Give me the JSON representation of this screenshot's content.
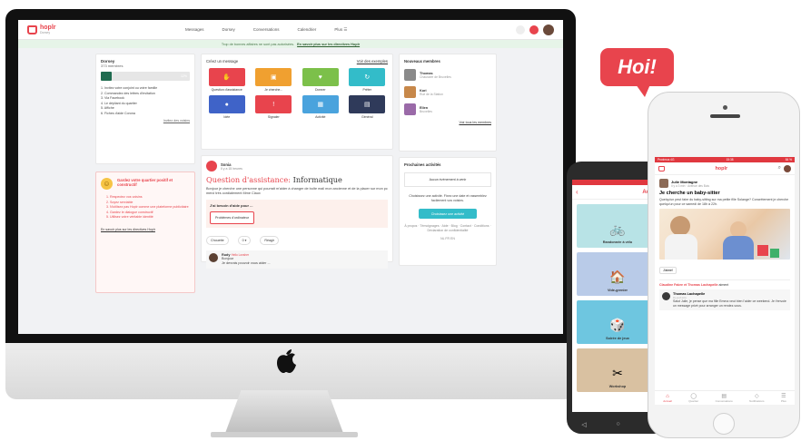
{
  "bubble": {
    "text": "Hoi!"
  },
  "desktop": {
    "logo": {
      "name": "hoplr",
      "sub": "Dorsey"
    },
    "nav": [
      "Messages",
      "Dorsey",
      "Conversations",
      "Calendrier",
      "Plus ☰"
    ],
    "banner": {
      "text": "Trop de bonnes affaires ne sont pas autorisées.",
      "link": "En savoir plus sur les directives Hoplr"
    },
    "membership": {
      "title": "Dorsey",
      "count": "373 membres",
      "progress_label": "12%",
      "progress_fraction": 0.12,
      "steps": [
        "1. Invitez votre conjoint ou votre famille",
        "2. Commandez des lettres d'invitation",
        "3. Via Facebook",
        "4. Le dépliant du quartier",
        "5. Affiche",
        "6. Fiches d'aide Corona"
      ],
      "link": "Invitez des voisins"
    },
    "guard": {
      "title": "Gardez votre quartier positif et constructif",
      "items": [
        "1. Respectez vos voisins",
        "2. Soyez serviable",
        "3. N'utilisez pas Hoplr comme une plateforme publicitaire",
        "4. Gardez le dialogue constructif",
        "5. Utilisez votre véritable identité"
      ],
      "link": "En savoir plus sur les directives Hoplr"
    },
    "create": {
      "title": "Créez un message",
      "link": "Voir des exemples",
      "tiles": [
        {
          "label": "Question d'assistance",
          "color": "#e8444d",
          "icon": "✋"
        },
        {
          "label": "Je cherche...",
          "color": "#f0a030",
          "icon": "▣"
        },
        {
          "label": "Donner",
          "color": "#7cc04a",
          "icon": "♥"
        },
        {
          "label": "Prêter",
          "color": "#33bcc9",
          "icon": "↻"
        },
        {
          "label": "Idée",
          "color": "#3f63c8",
          "icon": "●"
        },
        {
          "label": "Signaler",
          "color": "#e8444d",
          "icon": "!"
        },
        {
          "label": "Activité",
          "color": "#4aa3dd",
          "icon": "▦"
        },
        {
          "label": "Général",
          "color": "#2f3a5a",
          "icon": "▤"
        }
      ]
    },
    "post": {
      "author": "Sonia",
      "time": "Il y a 15 heures",
      "title_prefix": "Question d'assistance:",
      "title_topic": "Informatique",
      "body": "Bonjour je cherche une personne qui pourrait m'aider à changer de boîte mail mon ancienne et de la placer sur mon pc merci très cordialement Mme Claux",
      "need_title": "J'ai besoin d'aide pour ...",
      "need_button": "Problèmes d'ordinateur",
      "actions": [
        "Chouette",
        "0 ▾",
        "Réagir"
      ],
      "comment": {
        "name": "Rudy",
        "tag": "Hello Lonsher",
        "text1": "Bonjour",
        "text2": "Je devrais pouvoir vous aider ..."
      }
    },
    "new_members": {
      "title": "Nouveaux membres",
      "members": [
        {
          "name": "Thomas",
          "sub": "Chaussée de Bruxelles",
          "color": "#8a8a8a"
        },
        {
          "name": "Kori",
          "sub": "Rue de la Station",
          "color": "#c7884a"
        },
        {
          "name": "Ellen",
          "sub": "Bruxelles",
          "color": "#9a6aa8"
        }
      ],
      "link": "Voir tous les membres"
    },
    "activities": {
      "title": "Prochaines activités",
      "none": "Aucun événement à venir",
      "desc": "Choisissez une activité. Fixez une date et rassemblez facilement vos voisins.",
      "cta": "Choisissez une activité",
      "footer": "À propos · Témoignages · Aide · Blog · Contact · Conditions · Déclaration de confidentialité",
      "langs": "NL  FR  EN"
    }
  },
  "android": {
    "title": "Activ",
    "tiles": [
      {
        "label": "Randonnée à vélo",
        "color": "#b8e3e6",
        "icon": "🚲"
      },
      {
        "label": "Vide-grenier",
        "color": "#b9cbe8",
        "icon": "🏠"
      },
      {
        "label": "Soirée de jeux",
        "color": "#6ec6e0",
        "icon": "🎲"
      },
      {
        "label": "Workshop",
        "color": "#d9c1a1",
        "icon": "✂"
      }
    ]
  },
  "iphone": {
    "status_left": "Proximus 4G",
    "status_center": "15:38",
    "status_right": "84 %",
    "title": "hoplr",
    "post": {
      "author": "Julie Montagne",
      "time": "Il y a 3 min · Avenue des Buis",
      "title": "Je cherche un baby-sitter",
      "body": "Quelqu'un peut faire du baby-sitting sur ma petite fille Solange? Concrètement je cherche quelqu'un pour ce samedi de 18h à 22h.",
      "like": "J'aime!",
      "likers": "Claudine Fabre et Thomas Lachapelle",
      "likers_suffix": "aiment",
      "comment": {
        "name": "Thomas Lachapelle",
        "time": "Il y a 2 min",
        "text": "Salut Julie, je pense que ma fille Emma veut bien l'aider ce weekend. Je t'envoie un message privé pour arranger un rendez-vous."
      }
    },
    "tabs": [
      {
        "icon": "⌂",
        "label": "Accueil"
      },
      {
        "icon": "◯",
        "label": "Quartier"
      },
      {
        "icon": "▤",
        "label": "Conversations"
      },
      {
        "icon": "◇",
        "label": "Notifications"
      },
      {
        "icon": "☰",
        "label": "Plus"
      }
    ]
  }
}
